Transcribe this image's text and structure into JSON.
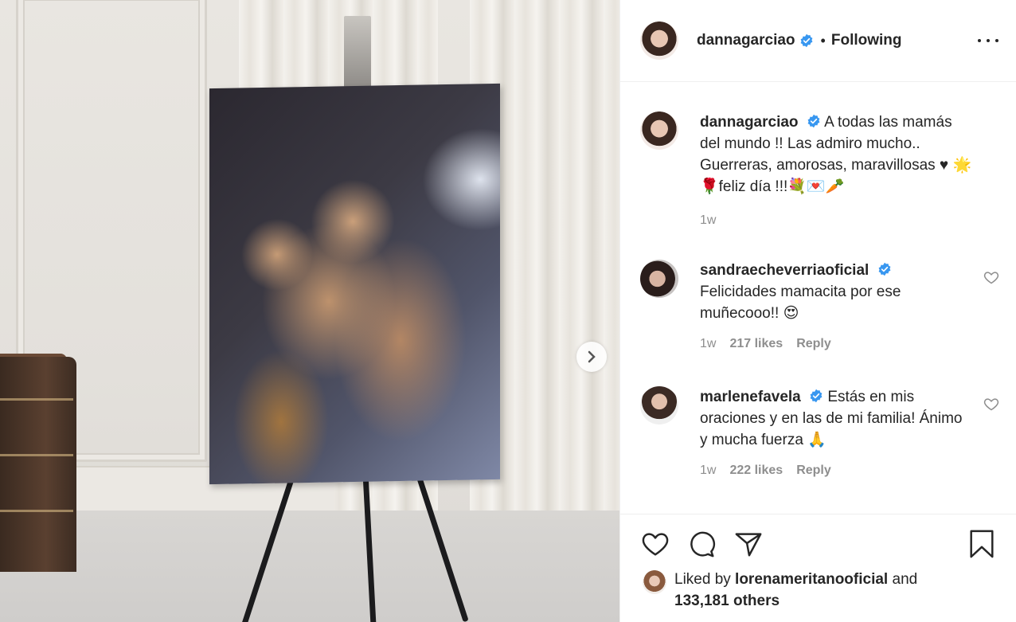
{
  "post": {
    "author": "dannagarciao",
    "follow_status": "Following",
    "separator": "•"
  },
  "caption": {
    "username": "dannagarciao",
    "text": "A todas las mamás del mundo !! Las admiro mucho.. Guerreras, amorosas, maravillosas ♥︎ 🌟🌹feliz día !!!💐💌🥕",
    "time": "1w"
  },
  "comments": [
    {
      "username": "sandraecheverriaoficial",
      "text": "Felicidades mamacita por ese muñecooo!! 😍",
      "time": "1w",
      "likes": "217 likes",
      "reply": "Reply"
    },
    {
      "username": "marlenefavela",
      "text": "Estás en mis oraciones y en las de mi familia! Ánimo y mucha fuerza 🙏",
      "time": "1w",
      "likes": "222 likes",
      "reply": "Reply"
    }
  ],
  "liked_by": {
    "prefix": "Liked by ",
    "user": "lorenameritanooficial",
    "and": " and",
    "others": "133,181 others"
  },
  "colors": {
    "verified": "#3897f0",
    "text": "#262626",
    "muted": "#8e8e8e",
    "border": "#efefef"
  },
  "icons": [
    "verified-badge-icon",
    "more-options-icon",
    "heart-icon",
    "comment-icon",
    "share-icon",
    "bookmark-icon",
    "chevron-right-icon"
  ]
}
